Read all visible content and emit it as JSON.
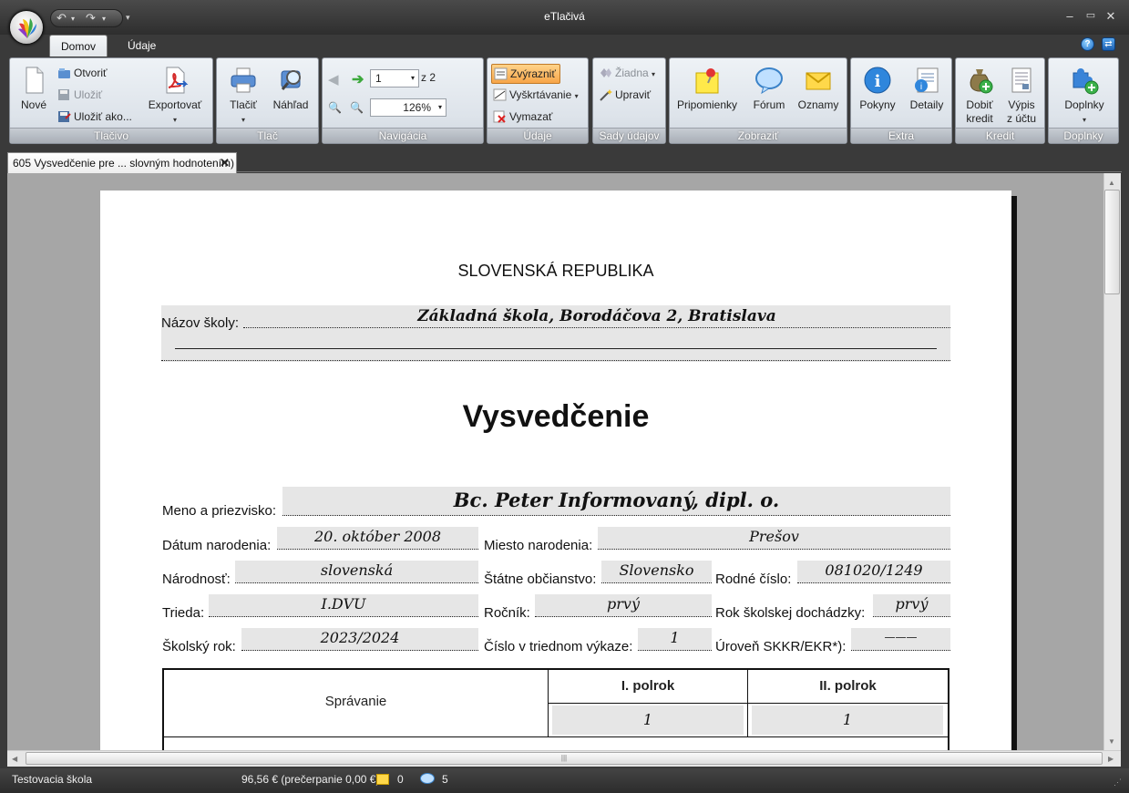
{
  "window": {
    "title": "eTlačivá"
  },
  "tabs": {
    "home": "Domov",
    "data": "Údaje"
  },
  "ribbon": {
    "tlacivo": {
      "caption": "Tlačivo",
      "new": "Nové",
      "open": "Otvoriť",
      "save": "Uložiť",
      "save_as": "Uložiť ako...",
      "export": "Exportovať"
    },
    "tlac": {
      "caption": "Tlač",
      "print": "Tlačiť",
      "preview": "Náhľad"
    },
    "navigacia": {
      "caption": "Navigácia",
      "page_value": "1",
      "page_total": "z 2",
      "zoom": "126%"
    },
    "udaje": {
      "caption": "Údaje",
      "highlight": "Zvýrazniť",
      "strike": "Vyškrtávanie",
      "clear": "Vymazať"
    },
    "sady": {
      "caption": "Sady údajov",
      "none": "Žiadna",
      "edit": "Upraviť"
    },
    "zobrazit": {
      "caption": "Zobraziť",
      "reminders": "Pripomienky",
      "forum": "Fórum",
      "notices": "Oznamy"
    },
    "extra": {
      "caption": "Extra",
      "instructions": "Pokyny",
      "details": "Detaily"
    },
    "kredit": {
      "caption": "Kredit",
      "topup_1": "Dobiť",
      "topup_2": "kredit",
      "statement_1": "Výpis",
      "statement_2": "z účtu"
    },
    "doplnky": {
      "caption": "Doplnky",
      "addons": "Doplnky"
    }
  },
  "document_tab": {
    "label": "605 Vysvedčenie pre ... slovným hodnotením)"
  },
  "form": {
    "header": "SLOVENSKÁ REPUBLIKA",
    "school_label": "Názov školy:",
    "school_value": "Základná škola, Borodáčova 2, Bratislava",
    "title": "Vysvedčenie",
    "name_label": "Meno a priezvisko:",
    "name_value": "Bc. Peter Informovaný, dipl. o.",
    "birthdate_label": "Dátum narodenia:",
    "birthdate_value": "20. október 2008",
    "birthplace_label": "Miesto narodenia:",
    "birthplace_value": "Prešov",
    "nationality_label": "Národnosť:",
    "nationality_value": "slovenská",
    "citizenship_label": "Štátne občianstvo:",
    "citizenship_value": "Slovensko",
    "birthnum_label": "Rodné číslo:",
    "birthnum_value": "081020/1249",
    "class_label": "Trieda:",
    "class_value": "I.DVU",
    "grade_label": "Ročník:",
    "grade_value": "prvý",
    "attendance_label": "Rok školskej dochádzky:",
    "attendance_value": "prvý",
    "schoolyear_label": "Školský rok:",
    "schoolyear_value": "2023/2024",
    "register_label": "Číslo v triednom výkaze:",
    "register_value": "1",
    "level_label": "Úroveň SKKR/EKR*):",
    "level_value": "———",
    "table": {
      "row_label": "Správanie",
      "col1": "I. polrok",
      "col2": "II. polrok",
      "val1": "1",
      "val2": "1"
    }
  },
  "status": {
    "school": "Testovacia škola",
    "credit": "96,56 € (prečerpanie 0,00 €)",
    "notices_count": "0",
    "messages_count": "5"
  }
}
